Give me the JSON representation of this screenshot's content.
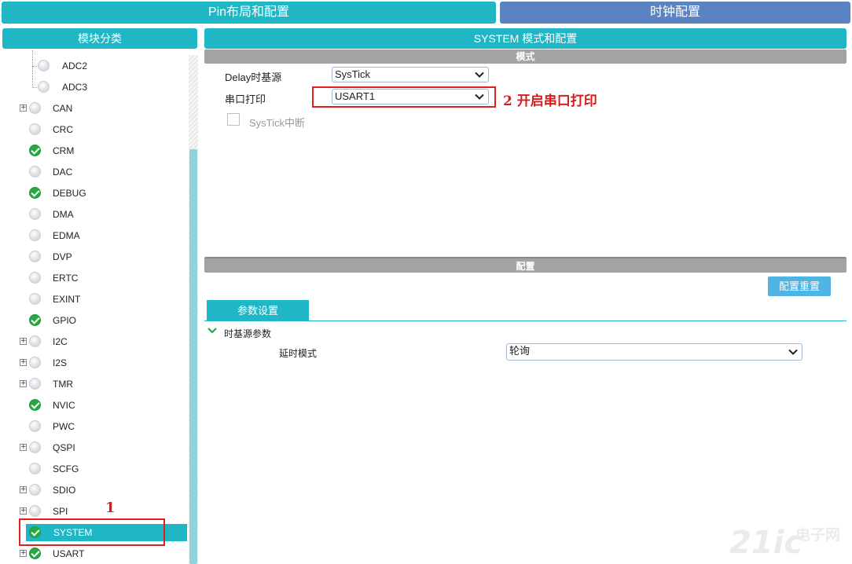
{
  "top_tabs": {
    "pin_layout": "Pin布局和配置",
    "clock_config": "时钟配置"
  },
  "left_panel": {
    "title": "模块分类",
    "items": [
      {
        "label": "ADC2",
        "status": "none",
        "expandable": false,
        "child": true
      },
      {
        "label": "ADC3",
        "status": "none",
        "expandable": false,
        "child": true
      },
      {
        "label": "CAN",
        "status": "none",
        "expandable": true
      },
      {
        "label": "CRC",
        "status": "none",
        "expandable": false
      },
      {
        "label": "CRM",
        "status": "ok",
        "expandable": false
      },
      {
        "label": "DAC",
        "status": "none",
        "expandable": false
      },
      {
        "label": "DEBUG",
        "status": "ok",
        "expandable": false
      },
      {
        "label": "DMA",
        "status": "none",
        "expandable": false
      },
      {
        "label": "EDMA",
        "status": "none",
        "expandable": false
      },
      {
        "label": "DVP",
        "status": "none",
        "expandable": false
      },
      {
        "label": "ERTC",
        "status": "none",
        "expandable": false
      },
      {
        "label": "EXINT",
        "status": "none",
        "expandable": false
      },
      {
        "label": "GPIO",
        "status": "ok",
        "expandable": false
      },
      {
        "label": "I2C",
        "status": "none",
        "expandable": true
      },
      {
        "label": "I2S",
        "status": "none",
        "expandable": true
      },
      {
        "label": "TMR",
        "status": "none",
        "expandable": true
      },
      {
        "label": "NVIC",
        "status": "ok",
        "expandable": false
      },
      {
        "label": "PWC",
        "status": "none",
        "expandable": false
      },
      {
        "label": "QSPI",
        "status": "none",
        "expandable": true
      },
      {
        "label": "SCFG",
        "status": "none",
        "expandable": false
      },
      {
        "label": "SDIO",
        "status": "none",
        "expandable": true
      },
      {
        "label": "SPI",
        "status": "none",
        "expandable": true
      },
      {
        "label": "SYSTEM",
        "status": "ok",
        "expandable": false,
        "selected": true
      },
      {
        "label": "USART",
        "status": "ok",
        "expandable": true
      }
    ]
  },
  "right_panel": {
    "title": "SYSTEM 模式和配置",
    "mode_section": {
      "title": "模式",
      "delay_source_label": "Delay时基源",
      "delay_source_value": "SysTick",
      "serial_print_label": "串口打印",
      "serial_print_value": "USART1",
      "systick_interrupt_label": "SysTick中断",
      "systick_interrupt_checked": false
    },
    "config_section": {
      "title": "配置",
      "reset_button": "配置重置",
      "params_tab": "参数设置",
      "group_label": "时基源参数",
      "delay_mode_label": "延时模式",
      "delay_mode_value": "轮询"
    }
  },
  "annotations": {
    "step1": "1",
    "step2": "2  开启串口打印"
  },
  "watermark": {
    "big": "21ic",
    "line1": "电子网",
    "line2": ""
  },
  "colors": {
    "teal": "#1fb7c5",
    "blue_tab": "#5b83c3",
    "section_gray": "#a3a3a3",
    "ok_green": "#27a844",
    "annotation_red": "#e02020",
    "reset_button": "#4fb3e3"
  }
}
